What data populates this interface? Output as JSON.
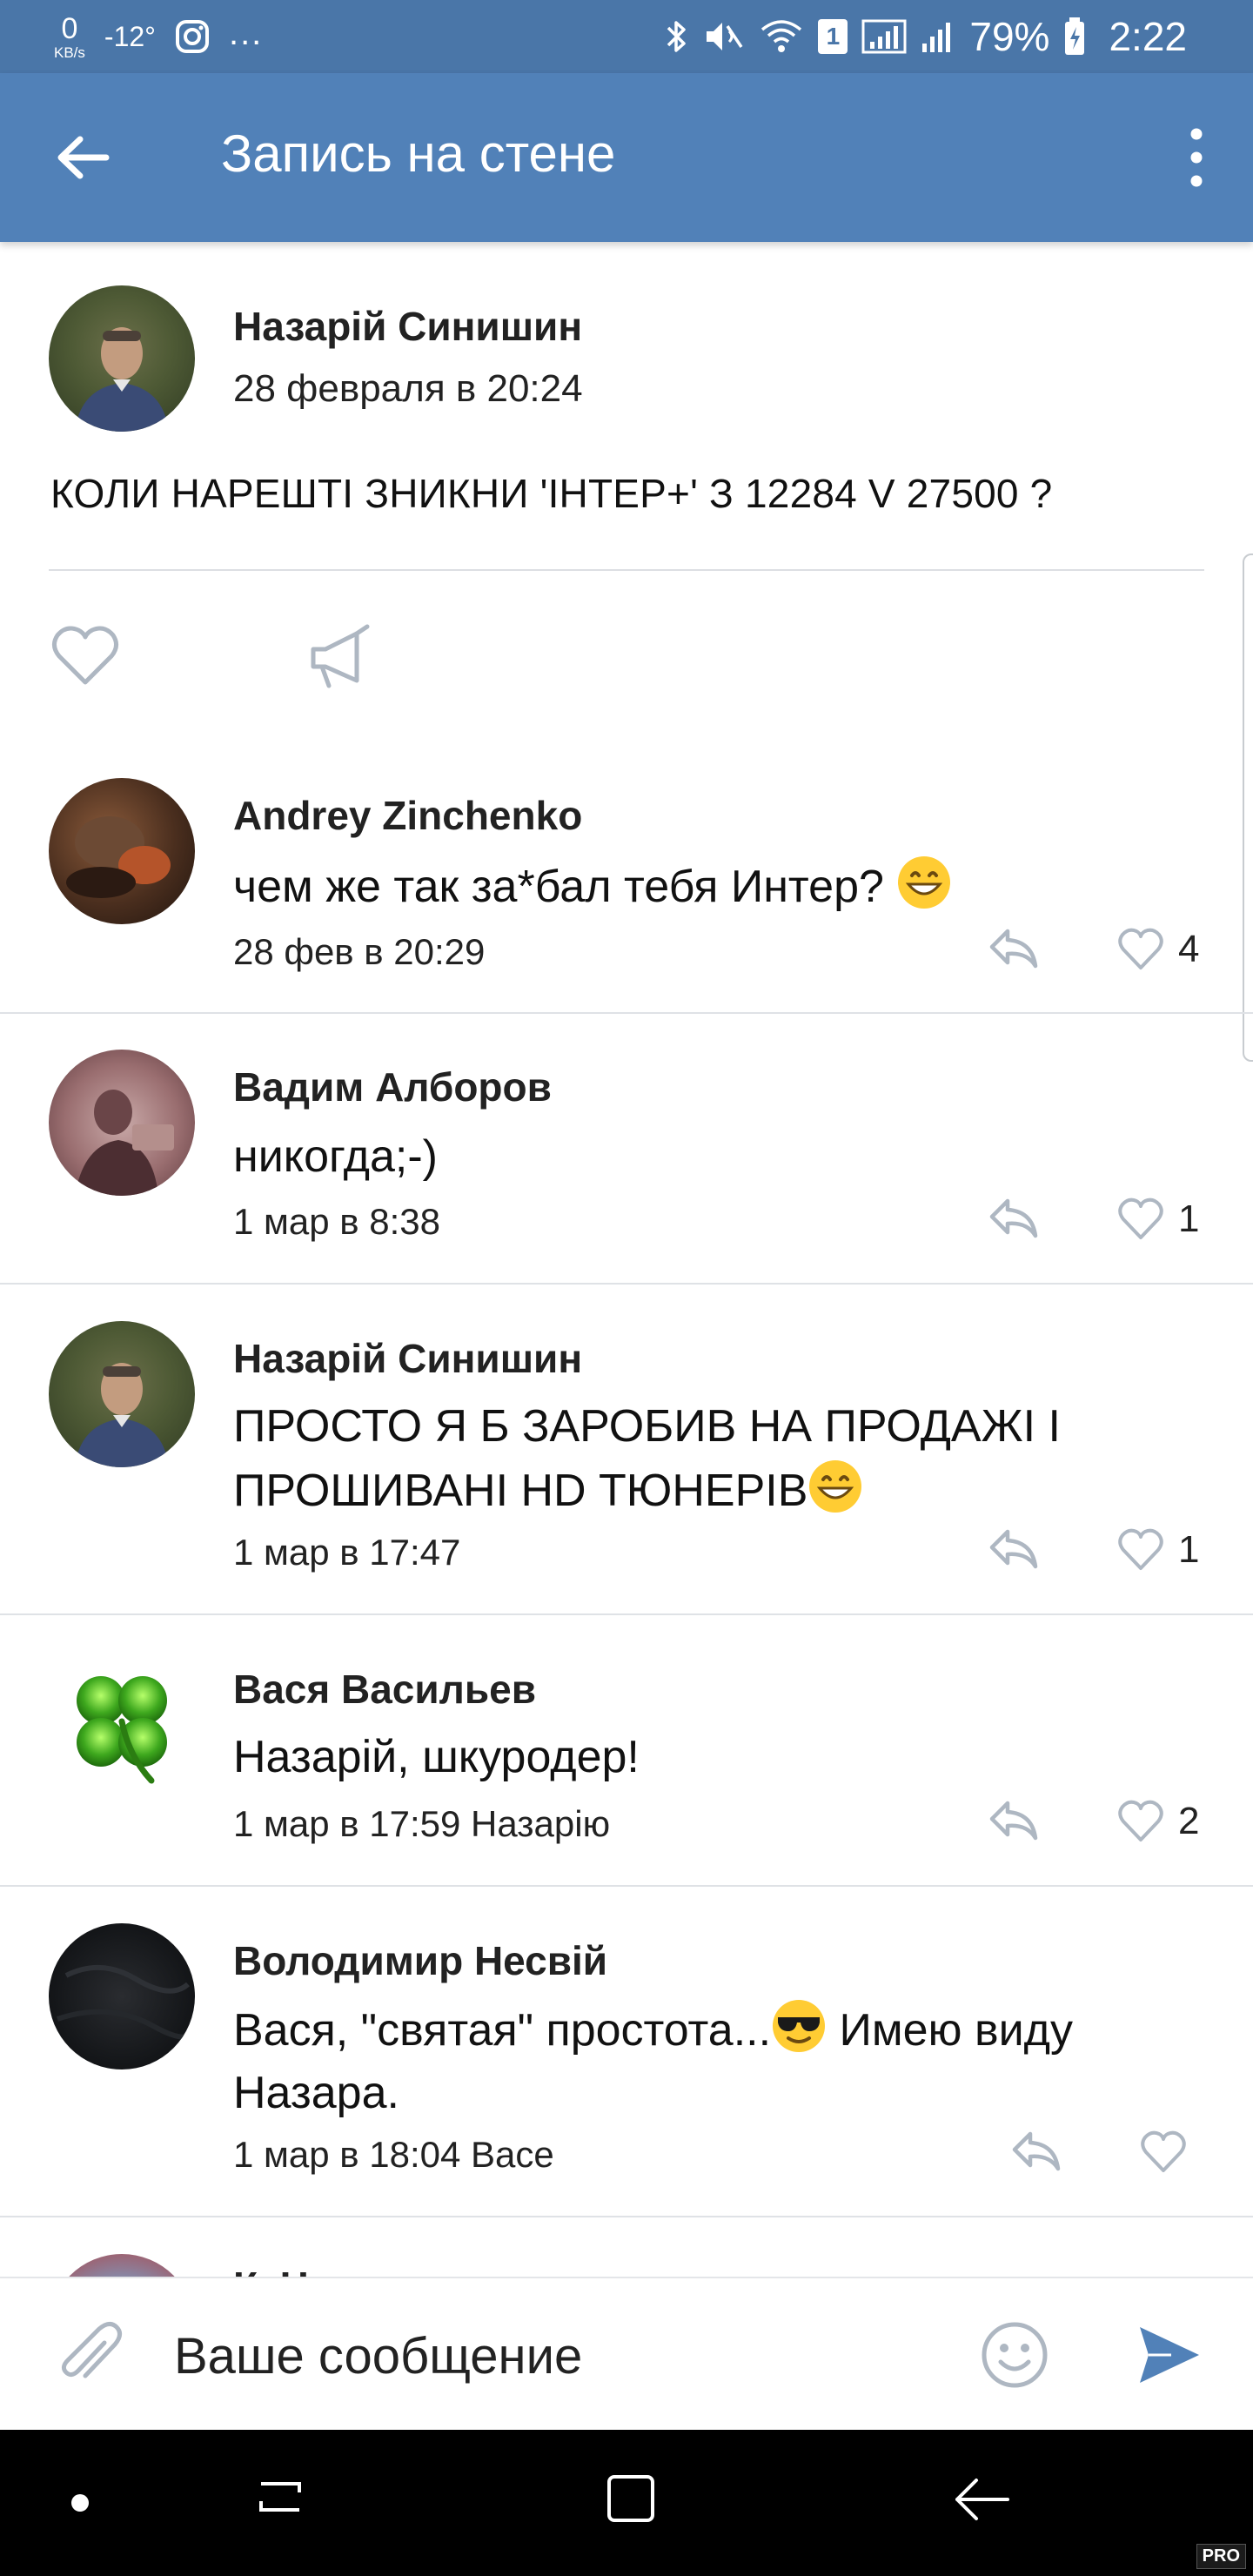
{
  "status_bar": {
    "speed_value": "0",
    "speed_unit": "KB/s",
    "temperature": "-12°",
    "more": "...",
    "sim_badge": "1",
    "battery_percent": "79%",
    "time": "2:22"
  },
  "app_bar": {
    "title": "Запись на стене"
  },
  "post": {
    "author": "Назарій Синишин",
    "date": "28 февраля в 20:24",
    "text": "КОЛИ НАРЕШТІ ЗНИКНИ 'ІНТЕР+' З 12284 V 27500 ?"
  },
  "comments": [
    {
      "name": "Andrey Zinchenko",
      "text": "чем же так за*бал тебя Интер? ",
      "meta": "28 фев в 20:29",
      "likes": "4"
    },
    {
      "name": "Вадим Алборов",
      "text": "никогда;-)",
      "meta": "1 мар в 8:38",
      "likes": "1"
    },
    {
      "name": "Назарій Синишин",
      "text_line1": "ПРОСТО Я Б ЗАРОБИВ НА ПРОДАЖІ І",
      "text_line2": "ПРОШИВАНІ HD ТЮНЕРІВ",
      "meta": "1 мар в 17:47",
      "likes": "1"
    },
    {
      "name": "Вася Васильев",
      "text": "Назарій, шкуродер!",
      "meta": "1 мар в 17:59 Назарію",
      "likes": "2"
    },
    {
      "name": "Володимир Несвій",
      "text_part1": "Вася, \"святая\" простота...",
      "text_part2": " Имею виду",
      "text_line2": "Назара.",
      "meta": "1 мар в 18:04 Васе",
      "likes": ""
    },
    {
      "name": "К. Н"
    }
  ],
  "input": {
    "placeholder": "Ваше сообщение"
  },
  "icons": {
    "back": "arrow-left-icon",
    "more": "more-vertical-icon",
    "like": "heart-icon",
    "share": "megaphone-icon",
    "reply": "reply-icon",
    "attach": "paperclip-icon",
    "emoji": "smile-icon",
    "send": "send-icon"
  },
  "colors": {
    "accent": "#5181b8",
    "status_bar": "#4a76a8",
    "icon_gray": "#aeb7c2",
    "send_blue": "#5181b8"
  },
  "watermark": "PRO"
}
